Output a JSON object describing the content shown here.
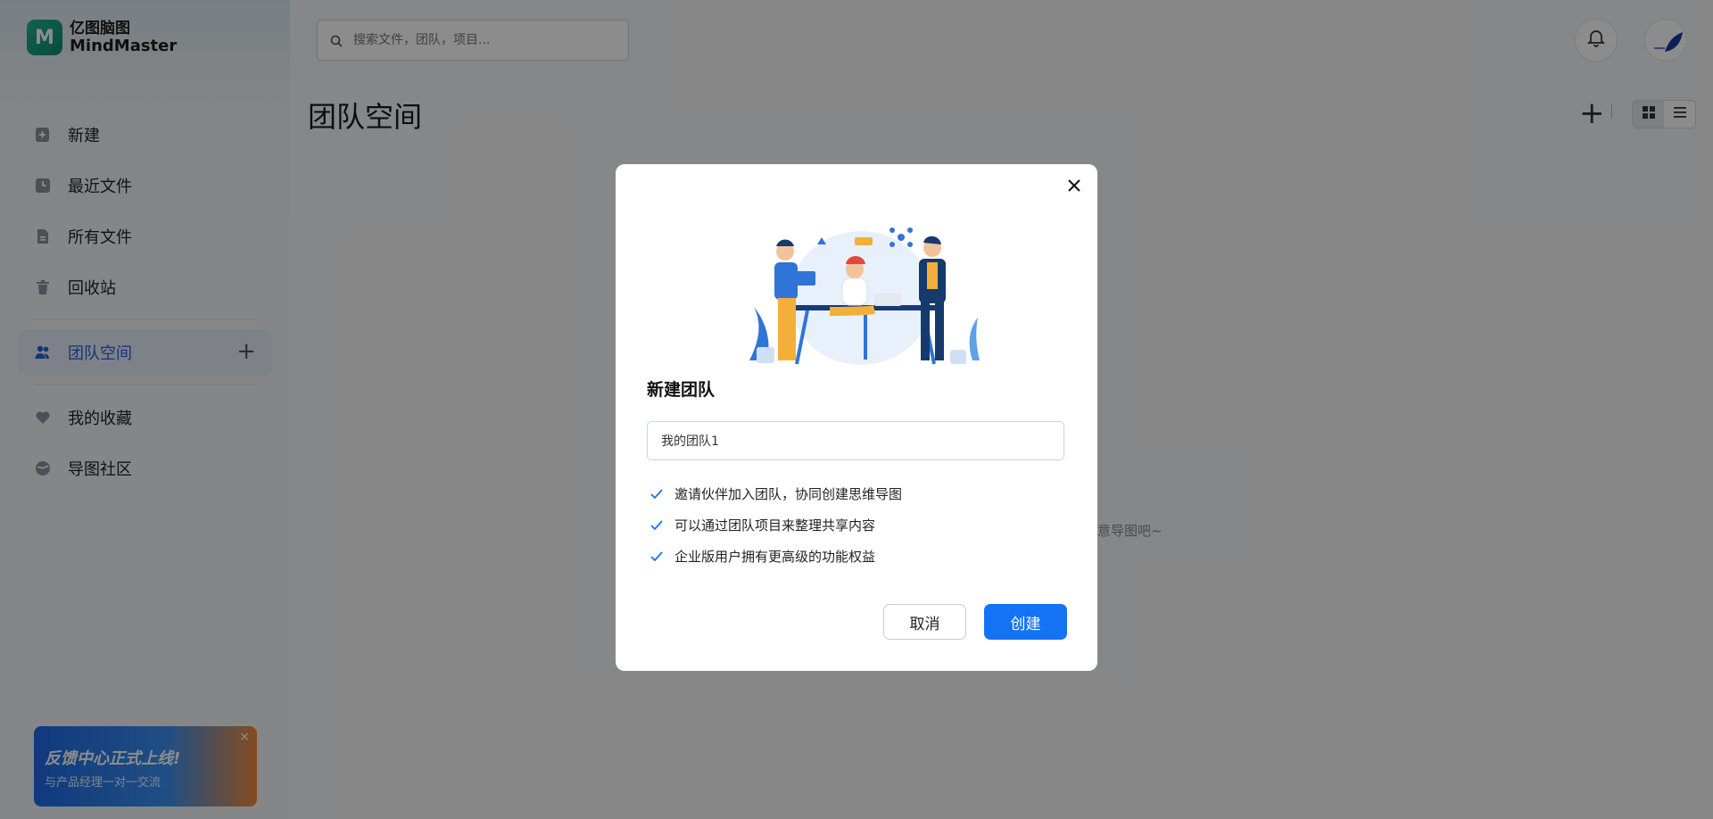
{
  "app": {
    "logo_cn": "亿图脑图",
    "logo_en": "MindMaster",
    "logo_letter": "M"
  },
  "search": {
    "placeholder": "搜索文件，团队，项目..."
  },
  "sidebar": {
    "items": [
      {
        "label": "新建",
        "icon": "new-file-icon"
      },
      {
        "label": "最近文件",
        "icon": "clock-icon"
      },
      {
        "label": "所有文件",
        "icon": "document-icon"
      },
      {
        "label": "回收站",
        "icon": "trash-icon"
      }
    ],
    "team": {
      "label": "团队空间",
      "icon": "team-icon",
      "plus": "+"
    },
    "extras": [
      {
        "label": "我的收藏",
        "icon": "heart-icon"
      },
      {
        "label": "导图社区",
        "icon": "community-icon"
      }
    ]
  },
  "banner": {
    "title": "反馈中心正式上线!",
    "subtitle": "与产品经理一对一交流",
    "close": "×"
  },
  "main": {
    "title": "团队空间",
    "add": "+",
    "empty_hint": "意导图吧~"
  },
  "dialog": {
    "title": "新建团队",
    "name_value": "我的团队1",
    "features": [
      "邀请伙伴加入团队，协同创建思维导图",
      "可以通过团队项目来整理共享内容",
      "企业版用户拥有更高级的功能权益"
    ],
    "cancel_label": "取消",
    "create_label": "创建"
  },
  "colors": {
    "accent": "#1473f5",
    "active_nav_bg": "#e5ecf7",
    "active_nav_text": "#2462d9",
    "overlay": "rgba(0,0,0,0.45)"
  }
}
